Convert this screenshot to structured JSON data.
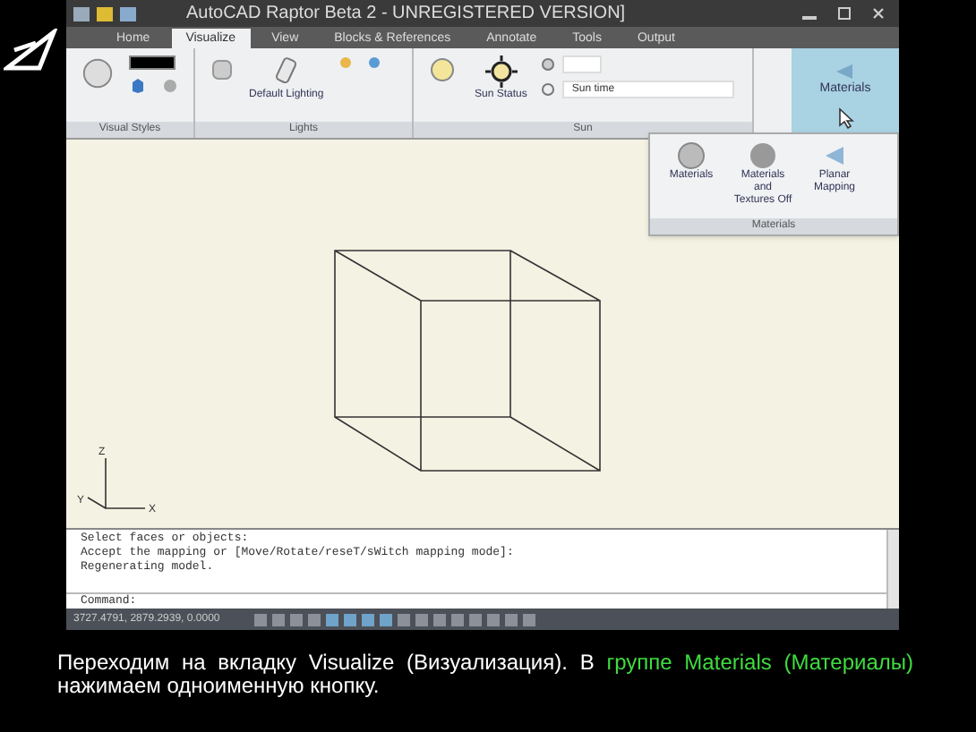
{
  "window": {
    "title": "AutoCAD Raptor Beta 2 - UNREGISTERED VERSION]"
  },
  "tabs": [
    {
      "label": "Home",
      "selected": false
    },
    {
      "label": "Visualize",
      "selected": true
    },
    {
      "label": "View",
      "selected": false
    },
    {
      "label": "Blocks & References",
      "selected": false
    },
    {
      "label": "Annotate",
      "selected": false
    },
    {
      "label": "Tools",
      "selected": false
    },
    {
      "label": "Output",
      "selected": false
    }
  ],
  "ribbon": {
    "panels": [
      {
        "kind": "styles",
        "label": "Visual Styles"
      },
      {
        "kind": "lights",
        "label": "Lights",
        "button": "Default Lighting"
      },
      {
        "kind": "sun",
        "label": "Sun",
        "button": "Sun Status",
        "field": "Sun time"
      }
    ],
    "materials_button": "Materials"
  },
  "materials_panel": {
    "buttons": [
      "Materials",
      "Materials and Textures Off",
      "Planar Mapping"
    ],
    "label": "Materials"
  },
  "ucs_axes": [
    "Z",
    "X",
    "Y"
  ],
  "command_history": [
    "Select faces or objects:",
    "Accept the mapping or [Move/Rotate/reseT/sWitch mapping mode]:",
    "Regenerating model."
  ],
  "command_prompt": "Command:",
  "status_bar": {
    "coordinates": "3727.4791, 2879.2939, 0.0000"
  },
  "caption": [
    {
      "text": "Переходим на вкладку Visualize (Визуализация). В ",
      "highlight": false
    },
    {
      "text": "группе Materials (Материалы)",
      "highlight": true
    },
    {
      "text": " нажимаем одноименную кнопку.",
      "highlight": false
    }
  ]
}
